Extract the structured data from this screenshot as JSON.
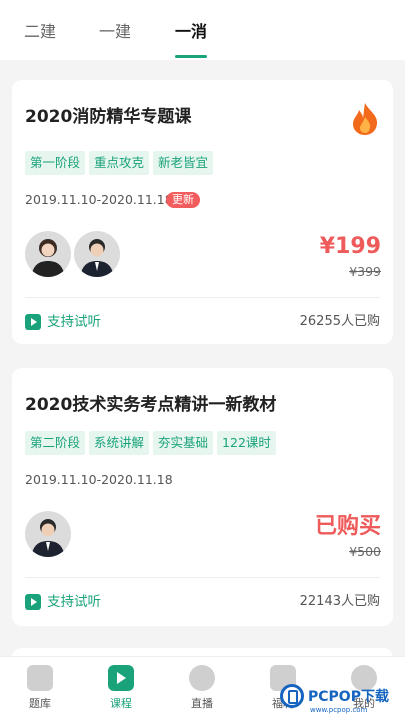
{
  "tabs": [
    {
      "label": "二建"
    },
    {
      "label": "一建"
    },
    {
      "label": "一消"
    }
  ],
  "cards": [
    {
      "title": "2020消防精华专题课",
      "tags": [
        "第一阶段",
        "重点攻克",
        "新老皆宜"
      ],
      "date_range": "2019.11.10-2020.11.18",
      "badge": "更新",
      "price": "¥199",
      "original_price": "¥399",
      "trial_label": "支持试听",
      "buyers": "26255人已购"
    },
    {
      "title": "2020技术实务考点精讲一新教材",
      "tags": [
        "第二阶段",
        "系统讲解",
        "夯实基础",
        "122课时"
      ],
      "date_range": "2019.11.10-2020.11.18",
      "price": "已购买",
      "original_price": "¥500",
      "trial_label": "支持试听",
      "buyers": "22143人已购"
    }
  ],
  "bottom_nav": [
    {
      "label": "题库",
      "icon": "pen-icon"
    },
    {
      "label": "课程",
      "icon": "video-play-icon"
    },
    {
      "label": "直播",
      "icon": "live-icon"
    },
    {
      "label": "福利",
      "icon": "gift-icon"
    },
    {
      "label": "我的",
      "icon": "user-icon"
    }
  ],
  "watermark": {
    "text": "PCPOP下载",
    "sub": "www.pcpop.com"
  },
  "colors": {
    "accent": "#1aa37a",
    "price": "#ef5a5a",
    "badge": "#f25c5c"
  }
}
